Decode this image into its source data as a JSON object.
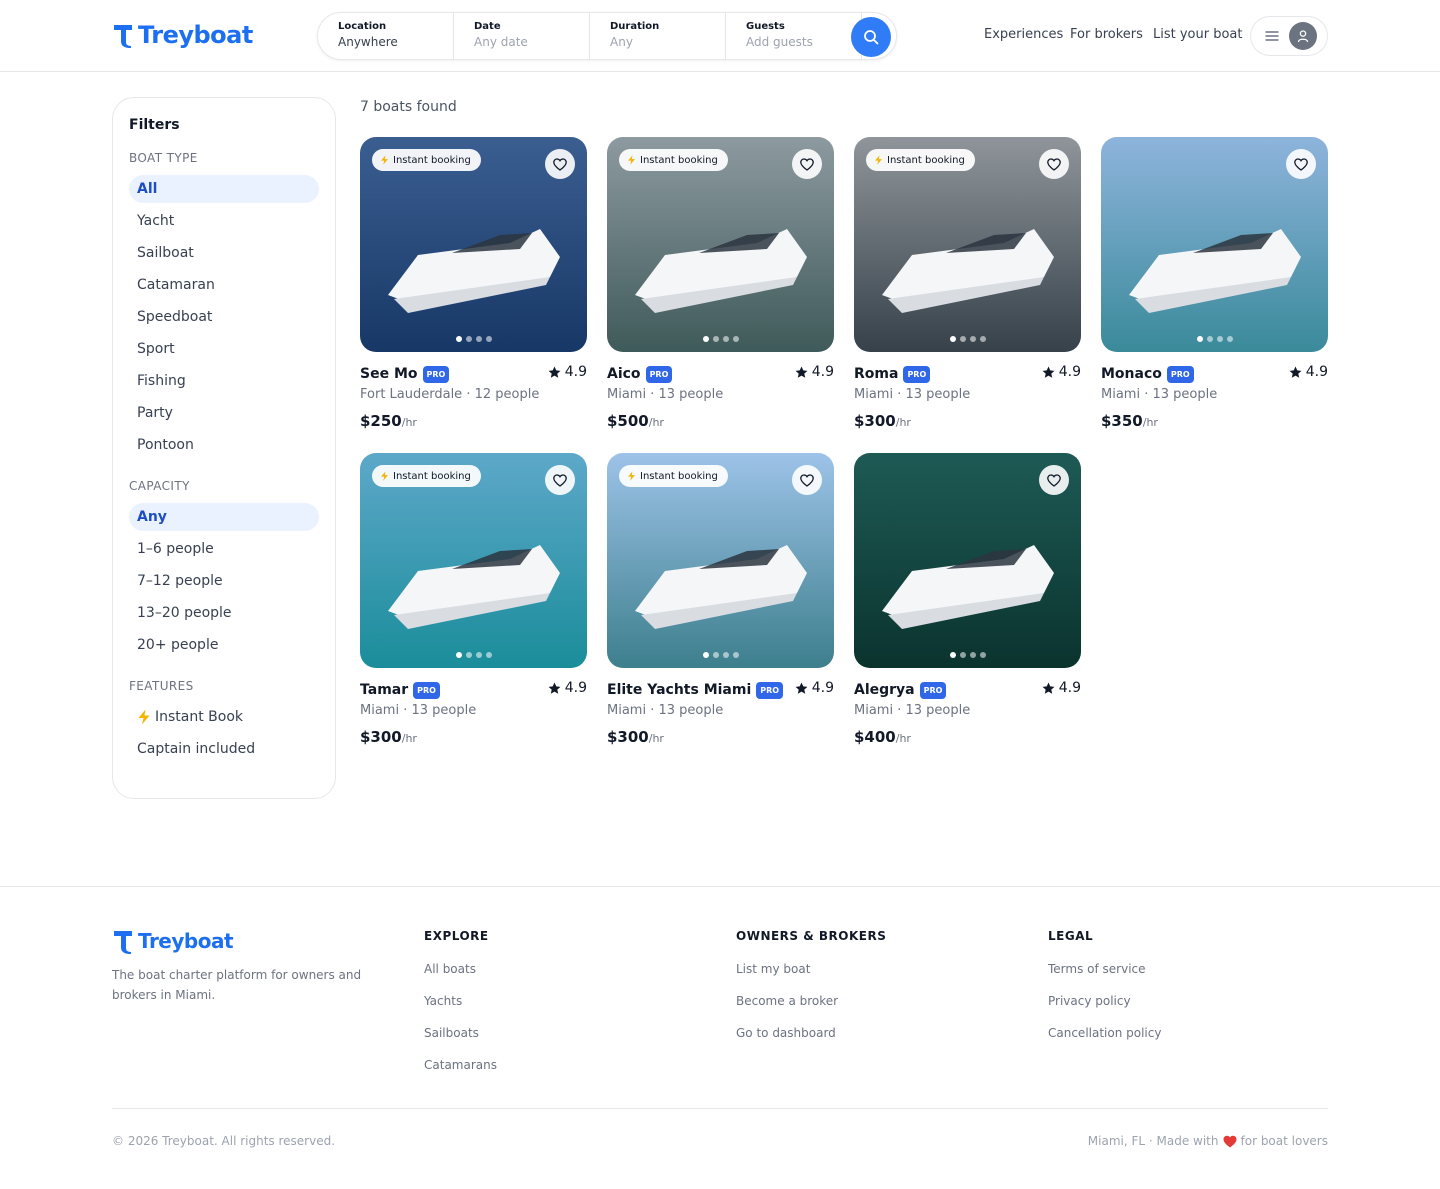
{
  "brand": {
    "name": "Treyboat",
    "color": "#1d6ff2"
  },
  "search": {
    "location": {
      "label": "Location",
      "value": "Anywhere"
    },
    "date": {
      "label": "Date",
      "value": "Any date"
    },
    "duration": {
      "label": "Duration",
      "value": "Any"
    },
    "guests": {
      "label": "Guests",
      "value": "Add guests"
    }
  },
  "nav": {
    "experiences": "Experiences",
    "brokers": "For brokers",
    "list": "List your boat"
  },
  "filters": {
    "title": "Filters",
    "boat_type": {
      "title": "BOAT TYPE",
      "options": [
        "All",
        "Yacht",
        "Sailboat",
        "Catamaran",
        "Speedboat",
        "Sport",
        "Fishing",
        "Party",
        "Pontoon"
      ],
      "selected": "All"
    },
    "capacity": {
      "title": "CAPACITY",
      "options": [
        "Any",
        "1–6 people",
        "7–12 people",
        "13–20 people",
        "20+ people"
      ],
      "selected": "Any"
    },
    "features": {
      "title": "FEATURES",
      "instant": "Instant Book",
      "captain": "Captain included"
    }
  },
  "results": {
    "count_text": "7 boats found",
    "instant_label": "Instant booking",
    "pro_label": "PRO",
    "per_hour": "/hr",
    "boats": [
      {
        "name": "See Mo",
        "rating": "4.9",
        "meta": "Fort Lauderdale · 12 people",
        "price": "$250",
        "instant": true
      },
      {
        "name": "Aico",
        "rating": "4.9",
        "meta": "Miami · 13 people",
        "price": "$500",
        "instant": true
      },
      {
        "name": "Roma",
        "rating": "4.9",
        "meta": "Miami · 13 people",
        "price": "$300",
        "instant": true
      },
      {
        "name": "Monaco",
        "rating": "4.9",
        "meta": "Miami · 13 people",
        "price": "$350",
        "instant": false
      },
      {
        "name": "Tamar",
        "rating": "4.9",
        "meta": "Miami · 13 people",
        "price": "$300",
        "instant": true
      },
      {
        "name": "Elite Yachts Miami",
        "rating": "4.9",
        "meta": "Miami · 13 people",
        "price": "$300",
        "instant": true
      },
      {
        "name": "Alegrya",
        "rating": "4.9",
        "meta": "Miami · 13 people",
        "price": "$400",
        "instant": false
      }
    ]
  },
  "footer": {
    "tagline": "The boat charter platform for owners and brokers in Miami.",
    "explore": {
      "title": "EXPLORE",
      "links": [
        "All boats",
        "Yachts",
        "Sailboats",
        "Catamarans"
      ]
    },
    "owners": {
      "title": "OWNERS & BROKERS",
      "links": [
        "List my boat",
        "Become a broker",
        "Go to dashboard"
      ]
    },
    "legal": {
      "title": "LEGAL",
      "links": [
        "Terms of service",
        "Privacy policy",
        "Cancellation policy"
      ]
    },
    "copyright": "© 2026 Treyboat. All rights reserved.",
    "made_pre": "Miami, FL · Made with",
    "made_post": "for boat lovers"
  }
}
